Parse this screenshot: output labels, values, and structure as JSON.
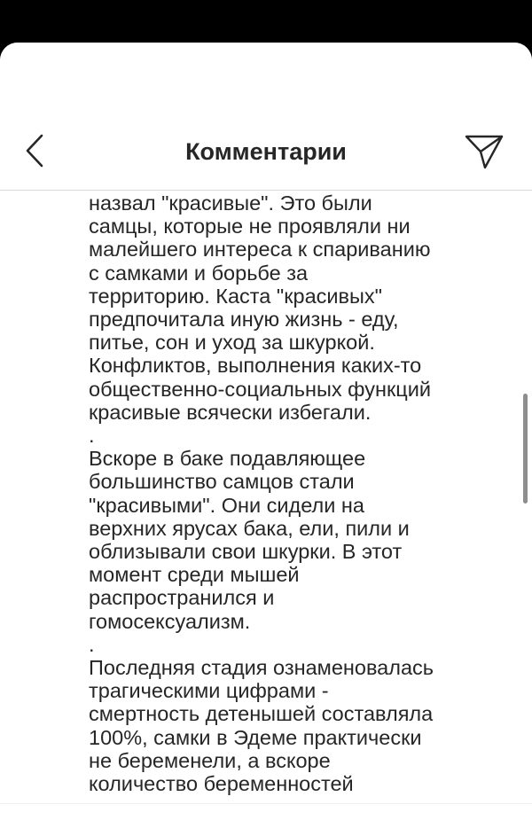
{
  "header": {
    "title": "Комментарии",
    "back_icon": "chevron-left-icon",
    "share_icon": "paper-plane-icon"
  },
  "comment": {
    "lines": [
      "назвал \"красивые\". Это были",
      "самцы, которые не проявляли ни",
      "малейшего интереса к спариванию",
      "с самками и борьбе за",
      "территорию. Каста \"красивых\"",
      "предпочитала иную жизнь - еду,",
      "питье, сон и уход за шкуркой.",
      "Конфликтов, выполнения каких-то",
      "общественно-социальных функций",
      "красивые всячески избегали.",
      ".",
      "Вскоре в баке подавляющее",
      "большинство самцов стали",
      "\"красивыми\". Они сидели на",
      "верхних ярусах бака, ели, пили и",
      "облизывали свои шкурки. В этот",
      "момент среди мышей",
      "распространился и",
      "гомосексуализм.",
      ".",
      "Последняя стадия ознаменовалась",
      "трагическими цифрами -",
      "смертность детенышей составляла",
      "100%, самки в Эдеме практически",
      "не беременели, а вскоре",
      "количество беременностей"
    ]
  },
  "colors": {
    "text": "#262626",
    "background": "#ffffff",
    "divider": "#dbdbdb"
  }
}
